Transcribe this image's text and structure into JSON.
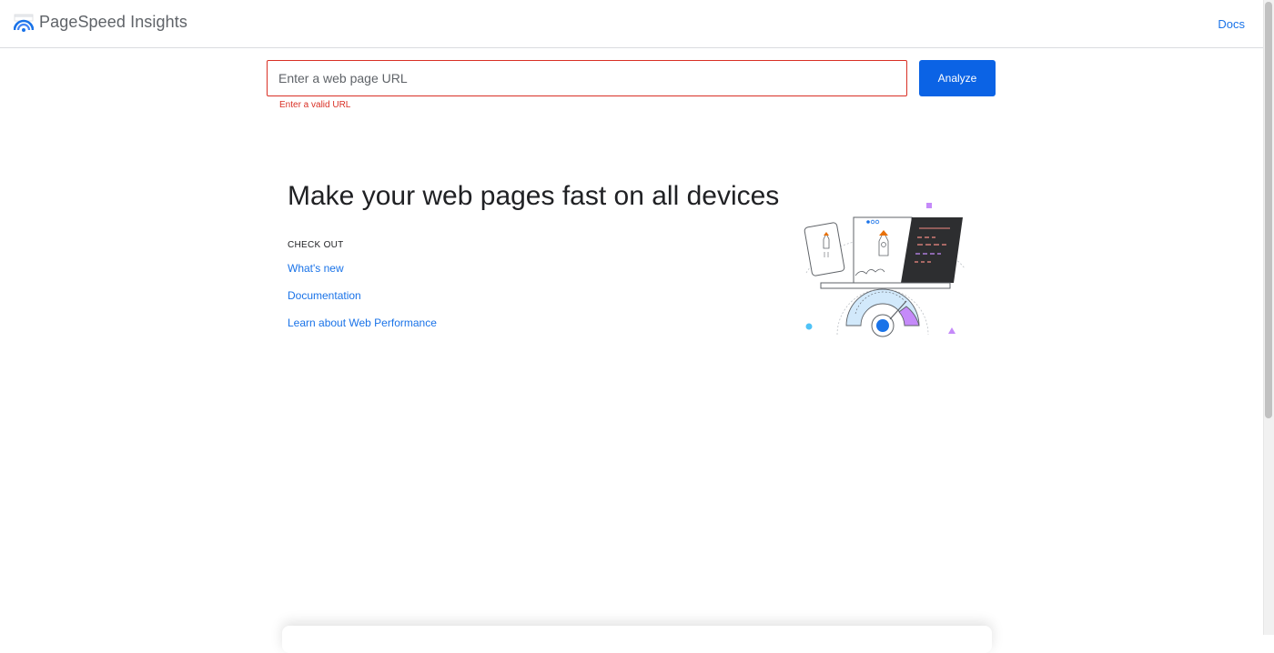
{
  "header": {
    "app_title": "PageSpeed Insights",
    "docs_label": "Docs"
  },
  "search": {
    "placeholder": "Enter a web page URL",
    "value": "",
    "error": "Enter a valid URL",
    "analyze_label": "Analyze"
  },
  "hero": {
    "headline": "Make your web pages fast on all devices",
    "check_out_label": "CHECK OUT",
    "links": [
      "What's new",
      "Documentation",
      "Learn about Web Performance"
    ]
  },
  "colors": {
    "accent": "#1a73e8",
    "button": "#0b63e5",
    "error": "#d93025"
  },
  "icons": {
    "logo": "pagespeed-logo-icon"
  }
}
